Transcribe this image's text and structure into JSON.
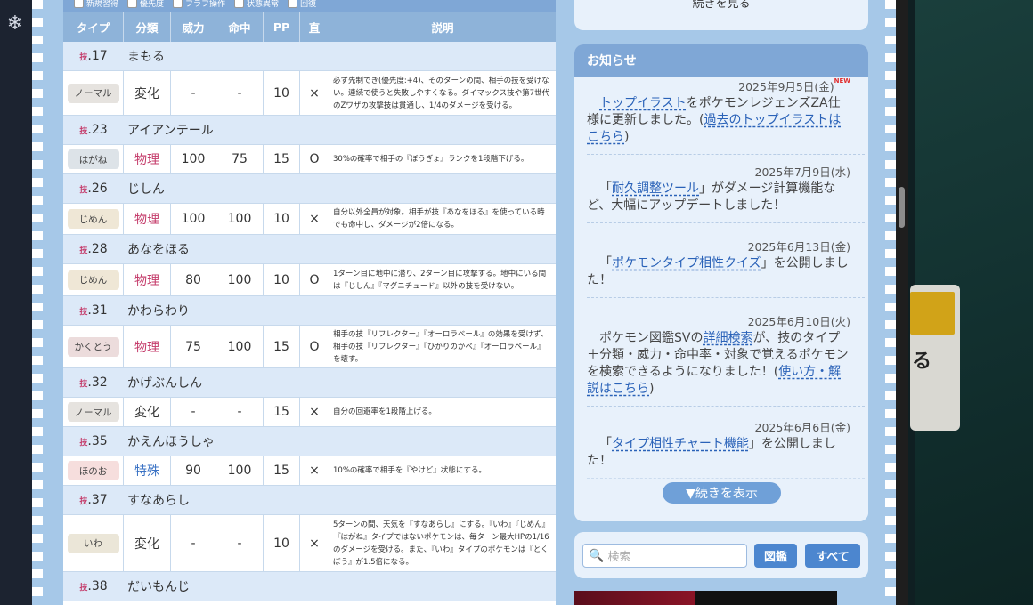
{
  "window": {
    "bg_icon": "snowflake-icon"
  },
  "filters": [
    "新規習得",
    "優先度",
    "フラフ操作",
    "状態異常",
    "回復"
  ],
  "table": {
    "headers": [
      "タイプ",
      "分類",
      "威力",
      "命中",
      "PP",
      "直",
      "説明"
    ],
    "tm_prefix": "技",
    "moves": [
      {
        "tm": ".17",
        "name": "まもる",
        "type": "ノーマル",
        "type_color": "#e6e3df",
        "category": "変化",
        "cat_class": "",
        "power": "-",
        "accuracy": "-",
        "pp": "10",
        "direct": "×",
        "desc": "必ず先制でき(優先度:+4)、そのターンの間、相手の技を受けない。連続で使うと失敗しやすくなる。ダイマックス技や第7世代のZワザの攻撃技は貫通し、1/4のダメージを受ける。",
        "h": 50
      },
      {
        "tm": ".23",
        "name": "アイアンテール",
        "type": "はがね",
        "type_color": "#dde3e8",
        "category": "物理",
        "cat_class": "phys",
        "power": "100",
        "accuracy": "75",
        "pp": "15",
        "direct": "O",
        "desc": "30%の確率で相手の『ぼうぎょ』ランクを1段階下げる。",
        "h": 33
      },
      {
        "tm": ".26",
        "name": "じしん",
        "type": "じめん",
        "type_color": "#efe7d6",
        "category": "物理",
        "cat_class": "phys",
        "power": "100",
        "accuracy": "100",
        "pp": "10",
        "direct": "×",
        "desc": "自分以外全員が対象。相手が技『あなをほる』を使っている時でも命中し、ダメージが2倍になる。",
        "h": 35
      },
      {
        "tm": ".28",
        "name": "あなをほる",
        "type": "じめん",
        "type_color": "#efe7d6",
        "category": "物理",
        "cat_class": "phys",
        "power": "80",
        "accuracy": "100",
        "pp": "10",
        "direct": "O",
        "desc": "1ターン目に地中に潜り、2ターン目に攻撃する。地中にいる間は『じしん』『マグニチュード』以外の技を受けない。",
        "h": 36
      },
      {
        "tm": ".31",
        "name": "かわらわり",
        "type": "かくとう",
        "type_color": "#ecdcdc",
        "category": "物理",
        "cat_class": "phys",
        "power": "75",
        "accuracy": "100",
        "pp": "15",
        "direct": "O",
        "desc": "相手の技『リフレクター』『オーロラベール』の効果を受けず、相手の技『リフレクター』『ひかりのかべ』『オーロラベール』を壊す。",
        "h": 48
      },
      {
        "tm": ".32",
        "name": "かげぶんしん",
        "type": "ノーマル",
        "type_color": "#e6e3df",
        "category": "変化",
        "cat_class": "",
        "power": "-",
        "accuracy": "-",
        "pp": "15",
        "direct": "×",
        "desc": "自分の回避率を1段階上げる。",
        "h": 33
      },
      {
        "tm": ".35",
        "name": "かえんほうしゃ",
        "type": "ほのお",
        "type_color": "#f6dedd",
        "category": "特殊",
        "cat_class": "spec",
        "power": "90",
        "accuracy": "100",
        "pp": "15",
        "direct": "×",
        "desc": "10%の確率で相手を『やけど』状態にする。",
        "h": 33
      },
      {
        "tm": ".37",
        "name": "すなあらし",
        "type": "いわ",
        "type_color": "#ebe6d8",
        "category": "変化",
        "cat_class": "",
        "power": "-",
        "accuracy": "-",
        "pp": "10",
        "direct": "×",
        "desc": "5ターンの間、天気を『すなあらし』にする。『いわ』『じめん』『はがね』タイプではないポケモンは、毎ターン最大HPの1/16のダメージを受ける。また、『いわ』タイプのポケモンは『とくぼう』が1.5倍になる。",
        "h": 64
      },
      {
        "tm": ".38",
        "name": "だいもんじ"
      }
    ]
  },
  "sidebar": {
    "top_more": "続きを見る",
    "news_title": "お知らせ",
    "news": [
      {
        "date": "2025年9月5日(金)",
        "new_label": "NEW",
        "parts": [
          [
            "link",
            "トップイラスト"
          ],
          [
            "text",
            "をポケモンレジェンズZA仕様に更新しました。("
          ],
          [
            "link",
            "過去のトップイラストはこちら"
          ],
          [
            "text",
            ")"
          ]
        ]
      },
      {
        "date": "2025年7月9日(水)",
        "parts": [
          [
            "text",
            "「"
          ],
          [
            "link",
            "耐久調整ツール"
          ],
          [
            "text",
            "」がダメージ計算機能など、大幅にアップデートしました！"
          ]
        ]
      },
      {
        "date": "2025年6月13日(金)",
        "parts": [
          [
            "text",
            "「"
          ],
          [
            "link",
            "ポケモンタイプ相性クイズ"
          ],
          [
            "text",
            "」を公開しました！"
          ]
        ]
      },
      {
        "date": "2025年6月10日(火)",
        "parts": [
          [
            "text",
            "ポケモン図鑑SVの"
          ],
          [
            "link",
            "詳細検索"
          ],
          [
            "text",
            "が、技のタイプ＋分類・威力・命中率・対象で覚えるポケモンを検索できるようになりました！("
          ],
          [
            "link",
            "使い方・解説はこちら"
          ],
          [
            "text",
            ")"
          ]
        ]
      },
      {
        "date": "2025年6月6日(金)",
        "parts": [
          [
            "text",
            "「"
          ],
          [
            "link",
            "タイプ相性チャート機能"
          ],
          [
            "text",
            "」を公開しました！"
          ]
        ]
      }
    ],
    "show_more": "▼続きを表示",
    "search_placeholder": "検索",
    "btn_zukan": "図鑑",
    "btn_all": "すべて"
  },
  "background": {
    "card_text": "る"
  }
}
